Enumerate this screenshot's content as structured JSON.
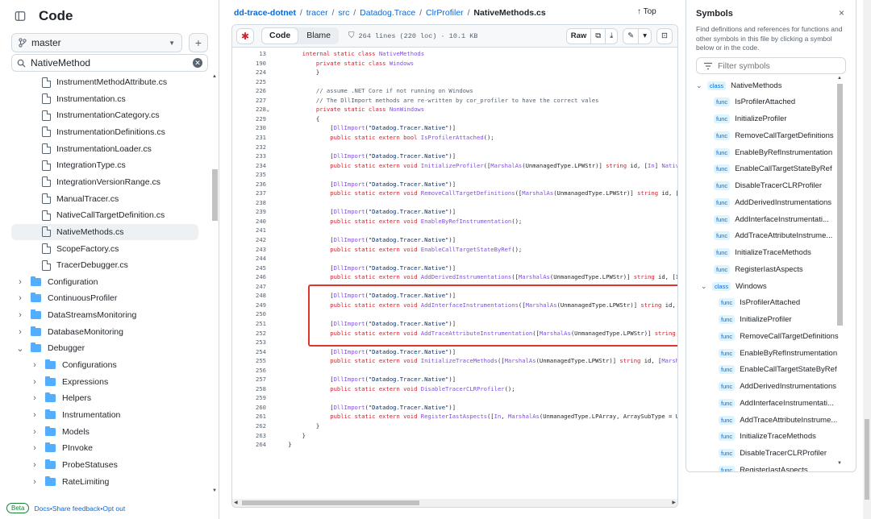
{
  "left": {
    "title": "Code",
    "branch": "master",
    "search_value": "NativeMethod",
    "items": [
      {
        "type": "file",
        "label": "InstrumentMethodAttribute.cs",
        "depth": 2
      },
      {
        "type": "file",
        "label": "Instrumentation.cs",
        "depth": 2
      },
      {
        "type": "file",
        "label": "InstrumentationCategory.cs",
        "depth": 2
      },
      {
        "type": "file",
        "label": "InstrumentationDefinitions.cs",
        "depth": 2
      },
      {
        "type": "file",
        "label": "InstrumentationLoader.cs",
        "depth": 2
      },
      {
        "type": "file",
        "label": "IntegrationType.cs",
        "depth": 2
      },
      {
        "type": "file",
        "label": "IntegrationVersionRange.cs",
        "depth": 2
      },
      {
        "type": "file",
        "label": "ManualTracer.cs",
        "depth": 2
      },
      {
        "type": "file",
        "label": "NativeCallTargetDefinition.cs",
        "depth": 2
      },
      {
        "type": "file",
        "label": "NativeMethods.cs",
        "depth": 2,
        "active": true
      },
      {
        "type": "file",
        "label": "ScopeFactory.cs",
        "depth": 2
      },
      {
        "type": "file",
        "label": "TracerDebugger.cs",
        "depth": 2
      },
      {
        "type": "folder",
        "label": "Configuration",
        "depth": 1,
        "open": false
      },
      {
        "type": "folder",
        "label": "ContinuousProfiler",
        "depth": 1,
        "open": false
      },
      {
        "type": "folder",
        "label": "DataStreamsMonitoring",
        "depth": 1,
        "open": false
      },
      {
        "type": "folder",
        "label": "DatabaseMonitoring",
        "depth": 1,
        "open": false
      },
      {
        "type": "folder",
        "label": "Debugger",
        "depth": 1,
        "open": true
      },
      {
        "type": "folder",
        "label": "Configurations",
        "depth": 2,
        "open": false
      },
      {
        "type": "folder",
        "label": "Expressions",
        "depth": 2,
        "open": false
      },
      {
        "type": "folder",
        "label": "Helpers",
        "depth": 2,
        "open": false
      },
      {
        "type": "folder",
        "label": "Instrumentation",
        "depth": 2,
        "open": false
      },
      {
        "type": "folder",
        "label": "Models",
        "depth": 2,
        "open": false
      },
      {
        "type": "folder",
        "label": "PInvoke",
        "depth": 2,
        "open": false
      },
      {
        "type": "folder",
        "label": "ProbeStatuses",
        "depth": 2,
        "open": false
      },
      {
        "type": "folder",
        "label": "RateLimiting",
        "depth": 2,
        "open": false
      }
    ],
    "footer": {
      "beta": "Beta",
      "docs": "Docs",
      "sep1": " • ",
      "feedback": "Share feedback",
      "sep2": " • ",
      "optout": "Opt out"
    }
  },
  "breadcrumb": {
    "repo": "dd-trace-dotnet",
    "parts": [
      "tracer",
      "src",
      "Datadog.Trace",
      "ClrProfiler"
    ],
    "sep": "/",
    "current": "NativeMethods.cs",
    "top": "↑ Top"
  },
  "toolbar": {
    "code_tab": "Code",
    "blame_tab": "Blame",
    "meta": "264 lines (220 loc) · 10.1 KB",
    "raw": "Raw"
  },
  "code_lines": [
    {
      "n": "13",
      "parts": [
        [
          "k",
          "        internal static class "
        ],
        [
          "t",
          "NativeMethods"
        ]
      ]
    },
    {
      "n": "190",
      "parts": [
        [
          "k",
          "            private static class "
        ],
        [
          "t",
          "Windows"
        ]
      ]
    },
    {
      "n": "224",
      "parts": [
        [
          "txt",
          "            }"
        ]
      ]
    },
    {
      "n": "225",
      "parts": []
    },
    {
      "n": "226",
      "parts": [
        [
          "c",
          "            // assume .NET Core if not running on Windows"
        ]
      ]
    },
    {
      "n": "227",
      "parts": [
        [
          "c",
          "            // The DllImport methods are re-written by cor_profiler to have the correct vales"
        ]
      ]
    },
    {
      "n": "228",
      "fold": "⌄",
      "parts": [
        [
          "k",
          "            private static class "
        ],
        [
          "t",
          "NonWindows"
        ]
      ]
    },
    {
      "n": "229",
      "parts": [
        [
          "txt",
          "            {"
        ]
      ]
    },
    {
      "n": "230",
      "parts": [
        [
          "txt",
          "                ["
        ],
        [
          "t",
          "DllImport"
        ],
        [
          "txt",
          "("
        ],
        [
          "s",
          "\"Datadog.Tracer.Native\""
        ],
        [
          "txt",
          ")]"
        ]
      ]
    },
    {
      "n": "231",
      "parts": [
        [
          "k",
          "                public static extern "
        ],
        [
          "k",
          "bool "
        ],
        [
          "t",
          "IsProfilerAttached"
        ],
        [
          "txt",
          "();"
        ]
      ]
    },
    {
      "n": "232",
      "parts": []
    },
    {
      "n": "233",
      "parts": [
        [
          "txt",
          "                ["
        ],
        [
          "t",
          "DllImport"
        ],
        [
          "txt",
          "("
        ],
        [
          "s",
          "\"Datadog.Tracer.Native\""
        ],
        [
          "txt",
          ")]"
        ]
      ]
    },
    {
      "n": "234",
      "parts": [
        [
          "k",
          "                public static extern void "
        ],
        [
          "t",
          "InitializeProfiler"
        ],
        [
          "txt",
          "(["
        ],
        [
          "t",
          "MarshalAs"
        ],
        [
          "txt",
          "(UnmanagedType.LPWStr)] "
        ],
        [
          "k",
          "string "
        ],
        [
          "txt",
          "id, ["
        ],
        [
          "t",
          "In"
        ],
        [
          "txt",
          "] "
        ],
        [
          "t",
          "NativeCallT"
        ]
      ]
    },
    {
      "n": "235",
      "parts": []
    },
    {
      "n": "236",
      "parts": [
        [
          "txt",
          "                ["
        ],
        [
          "t",
          "DllImport"
        ],
        [
          "txt",
          "("
        ],
        [
          "s",
          "\"Datadog.Tracer.Native\""
        ],
        [
          "txt",
          ")]"
        ]
      ]
    },
    {
      "n": "237",
      "parts": [
        [
          "k",
          "                public static extern void "
        ],
        [
          "t",
          "RemoveCallTargetDefinitions"
        ],
        [
          "txt",
          "(["
        ],
        [
          "t",
          "MarshalAs"
        ],
        [
          "txt",
          "(UnmanagedType.LPWStr)] "
        ],
        [
          "k",
          "string "
        ],
        [
          "txt",
          "id, ["
        ],
        [
          "t",
          "In"
        ],
        [
          "txt",
          "] "
        ],
        [
          "t",
          "Na"
        ]
      ]
    },
    {
      "n": "238",
      "parts": []
    },
    {
      "n": "239",
      "parts": [
        [
          "txt",
          "                ["
        ],
        [
          "t",
          "DllImport"
        ],
        [
          "txt",
          "("
        ],
        [
          "s",
          "\"Datadog.Tracer.Native\""
        ],
        [
          "txt",
          ")]"
        ]
      ]
    },
    {
      "n": "240",
      "parts": [
        [
          "k",
          "                public static extern void "
        ],
        [
          "t",
          "EnableByRefInstrumentation"
        ],
        [
          "txt",
          "();"
        ]
      ]
    },
    {
      "n": "241",
      "parts": []
    },
    {
      "n": "242",
      "parts": [
        [
          "txt",
          "                ["
        ],
        [
          "t",
          "DllImport"
        ],
        [
          "txt",
          "("
        ],
        [
          "s",
          "\"Datadog.Tracer.Native\""
        ],
        [
          "txt",
          ")]"
        ]
      ]
    },
    {
      "n": "243",
      "parts": [
        [
          "k",
          "                public static extern void "
        ],
        [
          "t",
          "EnableCallTargetStateByRef"
        ],
        [
          "txt",
          "();"
        ]
      ]
    },
    {
      "n": "244",
      "parts": []
    },
    {
      "n": "245",
      "parts": [
        [
          "txt",
          "                ["
        ],
        [
          "t",
          "DllImport"
        ],
        [
          "txt",
          "("
        ],
        [
          "s",
          "\"Datadog.Tracer.Native\""
        ],
        [
          "txt",
          ")]"
        ]
      ]
    },
    {
      "n": "246",
      "parts": [
        [
          "k",
          "                public static extern void "
        ],
        [
          "t",
          "AddDerivedInstrumentations"
        ],
        [
          "txt",
          "(["
        ],
        [
          "t",
          "MarshalAs"
        ],
        [
          "txt",
          "(UnmanagedType.LPWStr)] "
        ],
        [
          "k",
          "string "
        ],
        [
          "txt",
          "id, ["
        ],
        [
          "t",
          "In"
        ],
        [
          "txt",
          "] "
        ],
        [
          "t",
          "Nat"
        ]
      ]
    },
    {
      "n": "247",
      "parts": []
    },
    {
      "n": "248",
      "parts": [
        [
          "txt",
          "                ["
        ],
        [
          "t",
          "DllImport"
        ],
        [
          "txt",
          "("
        ],
        [
          "s",
          "\"Datadog.Tracer.Native\""
        ],
        [
          "txt",
          ")]"
        ]
      ]
    },
    {
      "n": "249",
      "parts": [
        [
          "k",
          "                public static extern void "
        ],
        [
          "t",
          "AddInterfaceInstrumentations"
        ],
        [
          "txt",
          "(["
        ],
        [
          "t",
          "MarshalAs"
        ],
        [
          "txt",
          "(UnmanagedType.LPWStr)] "
        ],
        [
          "k",
          "string "
        ],
        [
          "txt",
          "id, ["
        ],
        [
          "t",
          "In"
        ],
        [
          "txt",
          "] "
        ],
        [
          "t",
          "N"
        ]
      ]
    },
    {
      "n": "250",
      "parts": []
    },
    {
      "n": "251",
      "parts": [
        [
          "txt",
          "                ["
        ],
        [
          "t",
          "DllImport"
        ],
        [
          "txt",
          "("
        ],
        [
          "s",
          "\"Datadog.Tracer.Native\""
        ],
        [
          "txt",
          ")]"
        ]
      ]
    },
    {
      "n": "252",
      "parts": [
        [
          "k",
          "                public static extern void "
        ],
        [
          "t",
          "AddTraceAttributeInstrumentation"
        ],
        [
          "txt",
          "(["
        ],
        [
          "t",
          "MarshalAs"
        ],
        [
          "txt",
          "(UnmanagedType.LPWStr)] "
        ],
        [
          "k",
          "string "
        ],
        [
          "txt",
          "id, ["
        ],
        [
          "t",
          "I"
        ]
      ]
    },
    {
      "n": "253",
      "parts": []
    },
    {
      "n": "254",
      "parts": [
        [
          "txt",
          "                ["
        ],
        [
          "t",
          "DllImport"
        ],
        [
          "txt",
          "("
        ],
        [
          "s",
          "\"Datadog.Tracer.Native\""
        ],
        [
          "txt",
          ")]"
        ]
      ]
    },
    {
      "n": "255",
      "parts": [
        [
          "k",
          "                public static extern void "
        ],
        [
          "t",
          "InitializeTraceMethods"
        ],
        [
          "txt",
          "(["
        ],
        [
          "t",
          "MarshalAs"
        ],
        [
          "txt",
          "(UnmanagedType.LPWStr)] "
        ],
        [
          "k",
          "string "
        ],
        [
          "txt",
          "id, ["
        ],
        [
          "t",
          "MarshalAs"
        ],
        [
          "txt",
          "("
        ]
      ]
    },
    {
      "n": "256",
      "parts": []
    },
    {
      "n": "257",
      "parts": [
        [
          "txt",
          "                ["
        ],
        [
          "t",
          "DllImport"
        ],
        [
          "txt",
          "("
        ],
        [
          "s",
          "\"Datadog.Tracer.Native\""
        ],
        [
          "txt",
          ")]"
        ]
      ]
    },
    {
      "n": "258",
      "parts": [
        [
          "k",
          "                public static extern void "
        ],
        [
          "t",
          "DisableTracerCLRProfiler"
        ],
        [
          "txt",
          "();"
        ]
      ]
    },
    {
      "n": "259",
      "parts": []
    },
    {
      "n": "260",
      "parts": [
        [
          "txt",
          "                ["
        ],
        [
          "t",
          "DllImport"
        ],
        [
          "txt",
          "("
        ],
        [
          "s",
          "\"Datadog.Tracer.Native\""
        ],
        [
          "txt",
          ")]"
        ]
      ]
    },
    {
      "n": "261",
      "parts": [
        [
          "k",
          "                public static extern void "
        ],
        [
          "t",
          "RegisterIastAspects"
        ],
        [
          "txt",
          "(["
        ],
        [
          "t",
          "In"
        ],
        [
          "txt",
          ", "
        ],
        [
          "t",
          "MarshalAs"
        ],
        [
          "txt",
          "(UnmanagedType.LPArray, ArraySubType = Unmanag"
        ]
      ]
    },
    {
      "n": "262",
      "parts": [
        [
          "txt",
          "            }"
        ]
      ]
    },
    {
      "n": "263",
      "parts": [
        [
          "txt",
          "        }"
        ]
      ]
    },
    {
      "n": "264",
      "parts": [
        [
          "txt",
          "    }"
        ]
      ]
    }
  ],
  "symbols": {
    "title": "Symbols",
    "close": "×",
    "description": "Find definitions and references for functions and other symbols in this file by clicking a symbol below or in the code.",
    "filter_placeholder": "Filter symbols",
    "items": [
      {
        "kind": "class",
        "label": "NativeMethods",
        "depth": 0,
        "open": true
      },
      {
        "kind": "func",
        "label": "IsProfilerAttached",
        "depth": 1
      },
      {
        "kind": "func",
        "label": "InitializeProfiler",
        "depth": 1
      },
      {
        "kind": "func",
        "label": "RemoveCallTargetDefinitions",
        "depth": 1
      },
      {
        "kind": "func",
        "label": "EnableByRefInstrumentation",
        "depth": 1
      },
      {
        "kind": "func",
        "label": "EnableCallTargetStateByRef",
        "depth": 1
      },
      {
        "kind": "func",
        "label": "DisableTracerCLRProfiler",
        "depth": 1
      },
      {
        "kind": "func",
        "label": "AddDerivedInstrumentations",
        "depth": 1
      },
      {
        "kind": "func",
        "label": "AddInterfaceInstrumentati...",
        "depth": 1
      },
      {
        "kind": "func",
        "label": "AddTraceAttributeInstrume...",
        "depth": 1
      },
      {
        "kind": "func",
        "label": "InitializeTraceMethods",
        "depth": 1
      },
      {
        "kind": "func",
        "label": "RegisterIastAspects",
        "depth": 1
      },
      {
        "kind": "class",
        "label": "Windows",
        "depth": 1,
        "open": true
      },
      {
        "kind": "func",
        "label": "IsProfilerAttached",
        "depth": 2
      },
      {
        "kind": "func",
        "label": "InitializeProfiler",
        "depth": 2
      },
      {
        "kind": "func",
        "label": "RemoveCallTargetDefinitions",
        "depth": 2
      },
      {
        "kind": "func",
        "label": "EnableByRefInstrumentation",
        "depth": 2
      },
      {
        "kind": "func",
        "label": "EnableCallTargetStateByRef",
        "depth": 2
      },
      {
        "kind": "func",
        "label": "AddDerivedInstrumentations",
        "depth": 2
      },
      {
        "kind": "func",
        "label": "AddInterfaceInstrumentati...",
        "depth": 2
      },
      {
        "kind": "func",
        "label": "AddTraceAttributeInstrume...",
        "depth": 2
      },
      {
        "kind": "func",
        "label": "InitializeTraceMethods",
        "depth": 2
      },
      {
        "kind": "func",
        "label": "DisableTracerCLRProfiler",
        "depth": 2
      },
      {
        "kind": "func",
        "label": "RegisterIastAspects",
        "depth": 2
      }
    ]
  },
  "colors": {
    "accent": "#0969da",
    "highlight": "#e0352b",
    "folder": "#54aeff"
  }
}
